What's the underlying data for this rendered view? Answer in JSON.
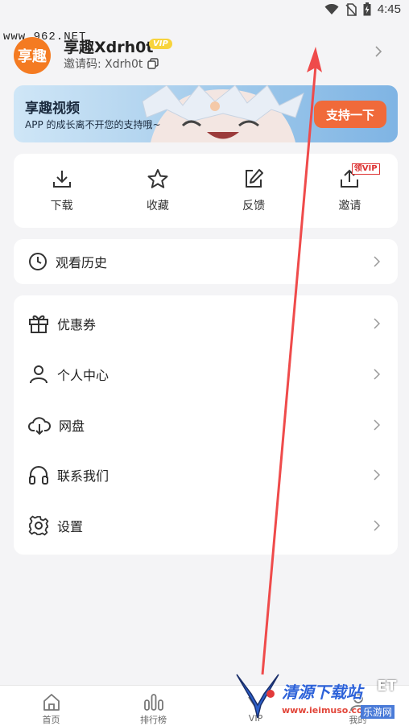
{
  "status_bar": {
    "time": "4:45",
    "icons": [
      "wifi-icon",
      "no-sim-icon",
      "battery-charging-icon"
    ]
  },
  "watermark_top": "www.962.NET",
  "profile": {
    "avatar_text": "享趣",
    "username": "享趣Xdrh0t",
    "vip_badge": "VIP",
    "invite_code_label": "邀请码: Xdrh0t"
  },
  "banner": {
    "title": "享趣视频",
    "subtitle": "APP 的成长离不开您的支持哦~",
    "button": "支持一下"
  },
  "quick_actions": [
    {
      "label": "下载",
      "icon": "download-icon"
    },
    {
      "label": "收藏",
      "icon": "star-icon"
    },
    {
      "label": "反馈",
      "icon": "edit-icon"
    },
    {
      "label": "邀请",
      "icon": "share-icon",
      "badge": "领VIP"
    }
  ],
  "history": {
    "label": "观看历史",
    "icon": "clock-icon"
  },
  "menu": [
    {
      "label": "优惠券",
      "icon": "gift-icon"
    },
    {
      "label": "个人中心",
      "icon": "user-icon"
    },
    {
      "label": "网盘",
      "icon": "cloud-download-icon"
    },
    {
      "label": "联系我们",
      "icon": "headphones-icon"
    },
    {
      "label": "设置",
      "icon": "gear-icon"
    }
  ],
  "tabbar": [
    {
      "label": "首页",
      "icon": "home-icon"
    },
    {
      "label": "排行榜",
      "icon": "ranking-icon"
    },
    {
      "label": "VIP",
      "icon": "vip-icon"
    },
    {
      "label": "我的",
      "icon": "profile-icon"
    }
  ],
  "watermark_bottom": {
    "brand": "清源下载站",
    "url": "www.ieimuso.com",
    "tag": "乐游网",
    "suffix": "ET"
  },
  "colors": {
    "accent": "#f06a3a",
    "avatar": "#f47b22",
    "vip": "#f7d33b",
    "arrow": "#ef4b4b"
  }
}
